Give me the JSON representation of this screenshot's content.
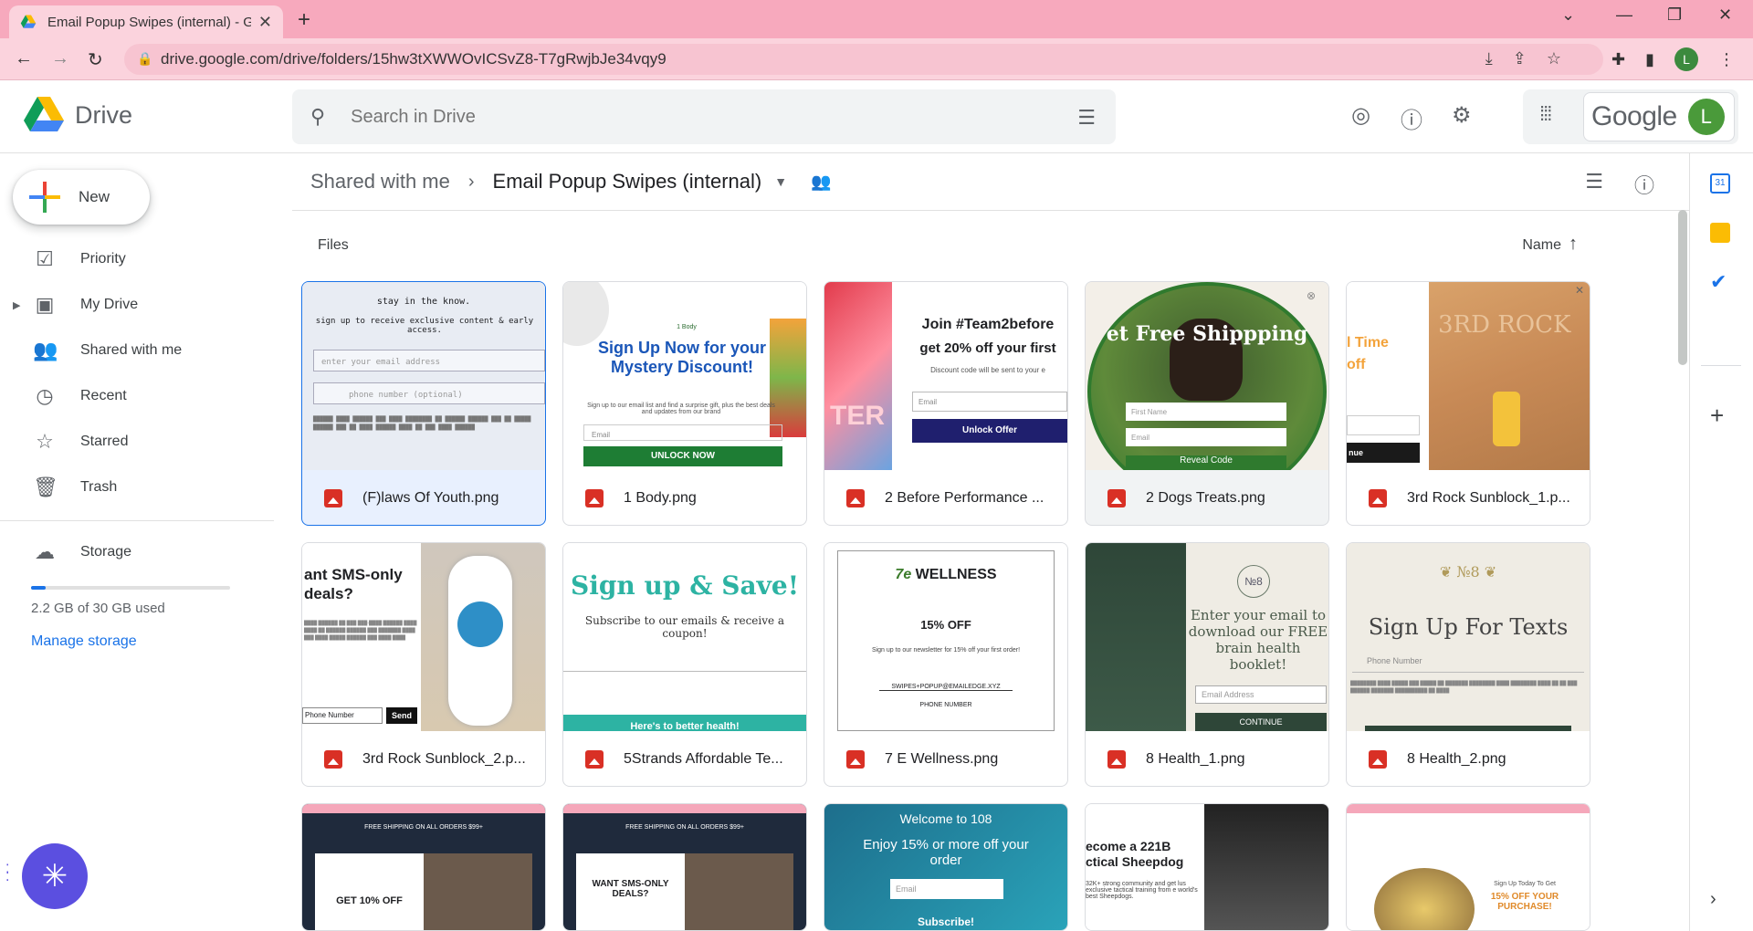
{
  "browser": {
    "tab_title": "Email Popup Swipes (internal) - G",
    "url": "drive.google.com/drive/folders/15hw3tXWWOvICSvZ8-T7gRwjbJe34vqy9",
    "profile_initial": "L"
  },
  "header": {
    "app_name": "Drive",
    "search_placeholder": "Search in Drive",
    "google_label": "Google",
    "avatar_initial": "L"
  },
  "sidebar": {
    "new_label": "New",
    "items": [
      {
        "label": "Priority",
        "icon": "priority-icon"
      },
      {
        "label": "My Drive",
        "icon": "my-drive-icon"
      },
      {
        "label": "Shared with me",
        "icon": "shared-icon"
      },
      {
        "label": "Recent",
        "icon": "clock-icon"
      },
      {
        "label": "Starred",
        "icon": "star-icon"
      },
      {
        "label": "Trash",
        "icon": "trash-icon"
      }
    ],
    "storage_label": "Storage",
    "storage_used": "2.2 GB of 30 GB used",
    "storage_fraction": 0.073,
    "manage_storage": "Manage storage"
  },
  "main": {
    "breadcrumb_parent": "Shared with me",
    "breadcrumb_current": "Email Popup Swipes (internal)",
    "section_label": "Files",
    "sort_label": "Name",
    "files": [
      {
        "name": "(F)laws Of Youth.png",
        "selected": true
      },
      {
        "name": "1 Body.png",
        "selected": false
      },
      {
        "name": "2 Before Performance ...",
        "selected": false
      },
      {
        "name": "2 Dogs Treats.png",
        "selected": false
      },
      {
        "name": "3rd Rock Sunblock_1.p...",
        "selected": false
      },
      {
        "name": "3rd Rock Sunblock_2.p...",
        "selected": false
      },
      {
        "name": "5Strands Affordable Te...",
        "selected": false
      },
      {
        "name": "7 E Wellness.png",
        "selected": false
      },
      {
        "name": "8 Health_1.png",
        "selected": false
      },
      {
        "name": "8 Health_2.png",
        "selected": false
      }
    ],
    "thumbs": {
      "t1_l1": "stay in the know.",
      "t1_l2": "sign up to receive exclusive content & early access.",
      "t1_email": "enter your email address",
      "t1_phone": "phone number (optional)",
      "t2_brand": "1 Body",
      "t2_head": "Sign Up Now for your Mystery Discount!",
      "t2_sub": "Sign up to our email list and find a surprise gift, plus the best deals and updates from our brand",
      "t2_email": "Email",
      "t2_btn": "UNLOCK NOW",
      "t3_head": "Join #Team2before",
      "t3_sub": "get 20% off your first",
      "t3_small": "Discount code will be sent to your e",
      "t3_email": "Email",
      "t3_btn": "Unlock Offer",
      "t3_side": "TER",
      "t4_head": "et Free Shippping",
      "t4_first": "First Name",
      "t4_email": "Email",
      "t4_btn": "Reveal Code",
      "t5_head": "l Time",
      "t5_head2": "off",
      "t5_brand": "3RD ROCK",
      "t5_btn": "nue",
      "t6_head": "ant SMS-only deals?",
      "t6_phone": "Phone Number",
      "t6_btn": "Send",
      "t7_head": "Sign up & Save!",
      "t7_sub": "Subscribe to our emails & receive a coupon!",
      "t7_foot": "Here's to better health!",
      "t8_brand": "WELLNESS",
      "t8_brand_num": "7e",
      "t8_off": "15% OFF",
      "t8_sub": "Sign up to our newsletter for 15% off your first order!",
      "t8_email": "SWIPES+POPUP@EMAILEDGE.XYZ",
      "t8_phone": "PHONE NUMBER",
      "t9_logo": "№8",
      "t9_head": "Enter your email to download our FREE brain health booklet!",
      "t9_email": "Email Address",
      "t9_btn": "CONTINUE",
      "t10_logo": "№8",
      "t10_head": "Sign Up For Texts",
      "t10_phone": "Phone Number",
      "t11_text": "GET 10% OFF",
      "t11_banner": "FREE SHIPPING ON ALL ORDERS $99+",
      "t12_text": "WANT SMS-ONLY DEALS?",
      "t12_banner": "FREE SHIPPING ON ALL ORDERS $99+",
      "t13_head": "Welcome to 108",
      "t13_sub": "Enjoy 15% or more off your order",
      "t13_email": "Email",
      "t13_btn": "Subscribe!",
      "t14_head": "ecome a 221B ctical Sheepdog",
      "t14_sub": "32K+ strong community and get lus exclusive tactical training from e world's best Sheepdogs.",
      "t15_head": "15% OFF YOUR PURCHASE!",
      "t15_sub": "Sign Up Today To Get"
    }
  },
  "colors": {
    "tabbar": "#f7a9bd",
    "accent": "#1a73e8",
    "fab": "#5b4fe0"
  }
}
